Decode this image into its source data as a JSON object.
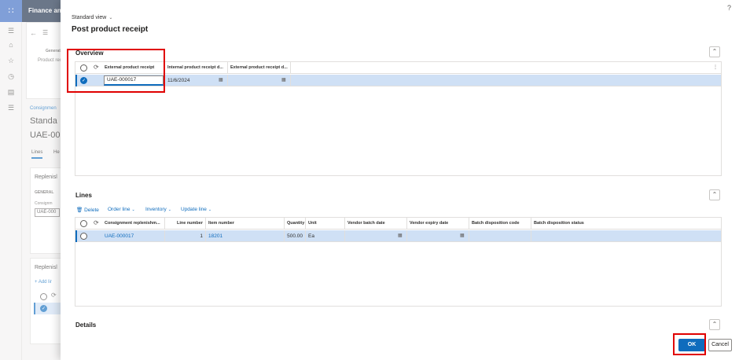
{
  "background": {
    "app_title": "Finance and",
    "nav": {
      "general_label": "Generat",
      "product_receipt_label": "Product rece"
    },
    "page": {
      "breadcrumb": "Consignmen",
      "view_title": "Standa",
      "record_id": "UAE-00",
      "tabs": [
        "Lines",
        "He"
      ],
      "replenish_section_1": "Replenisl",
      "general_label": "GENERAL",
      "consignment_label": "Consignm",
      "consignment_value": "UAE-000",
      "replenish_section_2": "Replenisl",
      "add_line_label": "+ Add lir"
    }
  },
  "dialog": {
    "help_glyph": "?",
    "view_selector": "Standard view",
    "title": "Post product receipt",
    "overview": {
      "label": "Overview",
      "columns": [
        "External product receipt",
        "Internal product receipt d...",
        "External product receipt d..."
      ],
      "rows": [
        {
          "external_product_receipt": "UAE-000017",
          "internal_product_receipt_date": "11/6/2024",
          "external_product_receipt_date": ""
        }
      ]
    },
    "lines": {
      "label": "Lines",
      "toolbar": {
        "delete": "Delete",
        "order_line": "Order line",
        "inventory": "Inventory",
        "update_line": "Update line"
      },
      "columns": [
        "Consignment replenishm...",
        "Line number",
        "Item number",
        "Quantity",
        "Unit",
        "Vendor batch date",
        "Vendor expiry date",
        "Batch disposition code",
        "Batch disposition status"
      ],
      "rows": [
        {
          "consignment_replenishment": "UAE-000017",
          "line_number": "1",
          "item_number": "18201",
          "quantity": "500.00",
          "unit": "Ea",
          "vendor_batch_date": "",
          "vendor_expiry_date": "",
          "batch_disposition_code": "",
          "batch_disposition_status": ""
        }
      ]
    },
    "details": {
      "label": "Details"
    },
    "buttons": {
      "ok": "OK",
      "cancel": "Cancel"
    }
  },
  "icons": {
    "waffle": "waffle-icon",
    "collapse": "chevron-up-icon",
    "refresh": "refresh-icon",
    "calendar": "calendar-icon",
    "delete": "trash-icon"
  },
  "colors": {
    "accent": "#0f6cbd",
    "selected_row": "#cfe0f5",
    "top_bar": "#1d2f4a",
    "annotation": "#e00000"
  }
}
